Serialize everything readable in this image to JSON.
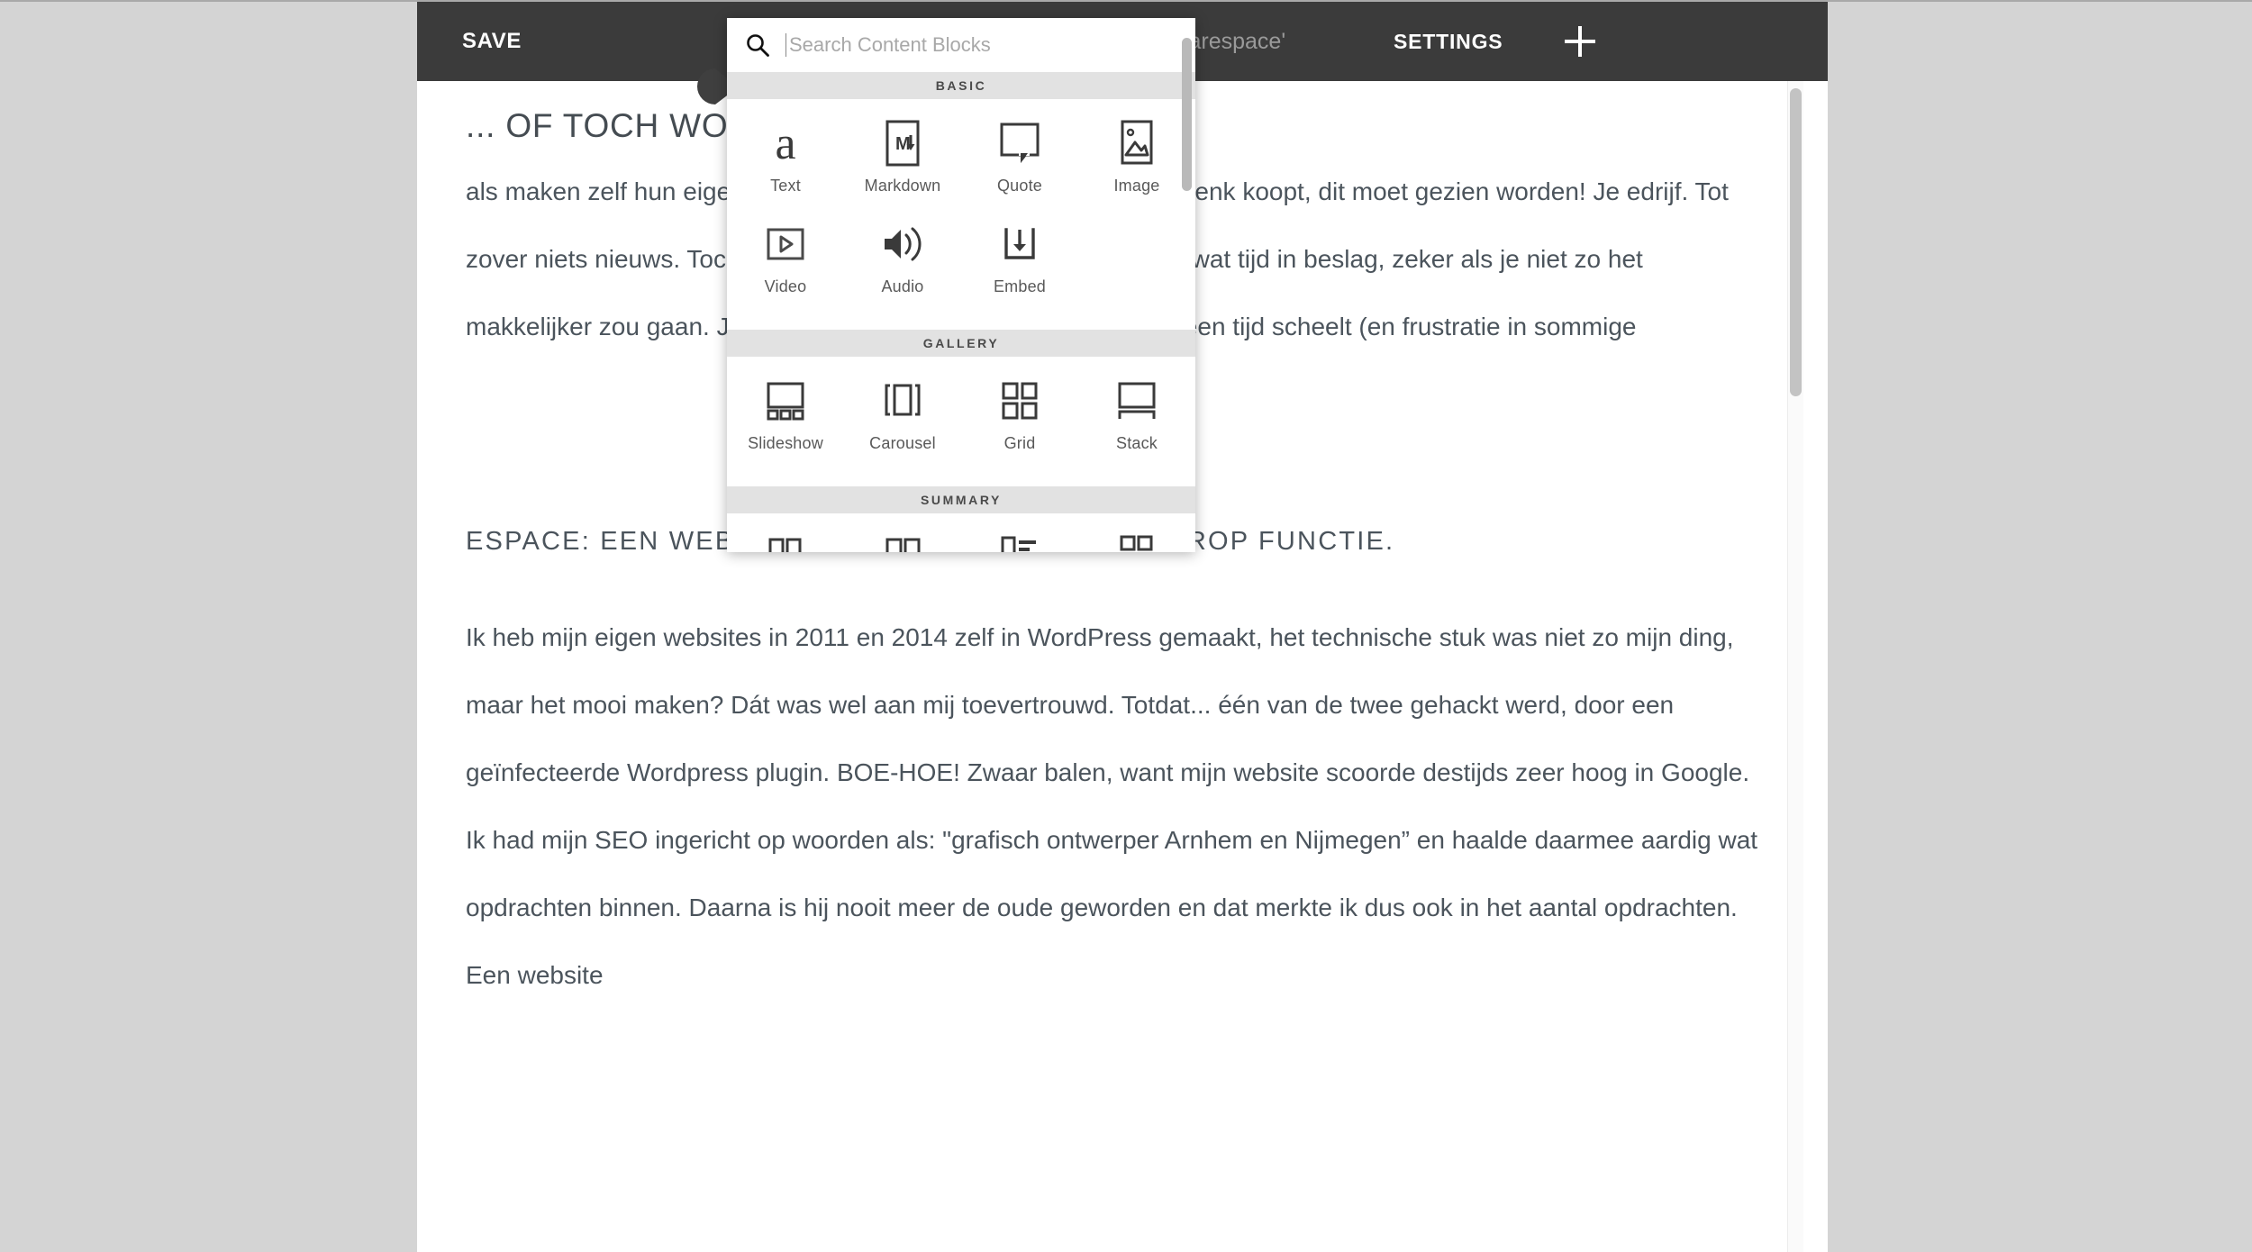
{
  "admin_bar": {
    "save_label": "SAVE",
    "middle_label": "Squarespace'",
    "settings_label": "SETTINGS",
    "add_icon": "plus-icon",
    "background": "#3b3b3b"
  },
  "insert_marker": {
    "icon": "insert-point-teardrop-icon",
    "color": "#3f3f3f"
  },
  "block_panel": {
    "search": {
      "icon": "search-icon",
      "placeholder": "Search Content Blocks",
      "value": ""
    },
    "groups": [
      {
        "title": "BASIC",
        "items": [
          {
            "label": "Text",
            "icon": "text-a-icon"
          },
          {
            "label": "Markdown",
            "icon": "markdown-icon"
          },
          {
            "label": "Quote",
            "icon": "quote-bubble-icon"
          },
          {
            "label": "Image",
            "icon": "image-icon"
          },
          {
            "label": "Video",
            "icon": "video-play-icon"
          },
          {
            "label": "Audio",
            "icon": "audio-speaker-icon"
          },
          {
            "label": "Embed",
            "icon": "embed-download-icon"
          }
        ]
      },
      {
        "title": "GALLERY",
        "items": [
          {
            "label": "Slideshow",
            "icon": "gallery-slideshow-icon"
          },
          {
            "label": "Carousel",
            "icon": "gallery-carousel-icon"
          },
          {
            "label": "Grid",
            "icon": "gallery-grid-icon"
          },
          {
            "label": "Stack",
            "icon": "gallery-stack-icon"
          }
        ]
      },
      {
        "title": "SUMMARY",
        "items": [
          {
            "label": "",
            "icon": "summary-wall-icon"
          },
          {
            "label": "",
            "icon": "summary-grid-icon"
          },
          {
            "label": "",
            "icon": "summary-list-icon"
          },
          {
            "label": "",
            "icon": "summary-carousel-icon"
          }
        ]
      }
    ]
  },
  "article": {
    "title": "... OF TOCH WORDPRESS?",
    "paragraph_1": "als maken zelf hun eigen website in e website kunnen beheren, denk koopt, dit moet gezien worden! Je edrijf. Tot zover niets nieuws. Toch makkelijk (en dat is het uiteindelijk ook) wat tijd in beslag, zeker als je niet zo het makkelijker zou gaan. Je wilt je n met je website. Uitbesteden is een tijd scheelt (en frustratie in sommige",
    "section_heading": "ESPACE: EEN WEBSITE PLATFORM MET DRAG & DROP FUNCTIE.",
    "paragraph_2": "Ik heb mijn eigen websites in 2011 en 2014 zelf in WordPress gemaakt, het technische stuk was niet zo mijn ding, maar het mooi maken? Dát was wel aan mij toevertrouwd.  Totdat... één van de twee gehackt werd, door een geïnfecteerde Wordpress plugin. BOE-HOE!  Zwaar balen, want mijn website scoorde destijds zeer hoog in Google. Ik had mijn SEO ingericht op woorden als: \"grafisch ontwerper Arnhem en Nijmegen” en haalde daarmee aardig wat opdrachten binnen. Daarna is hij nooit meer de oude geworden en dat merkte ik dus ook in het aantal opdrachten. Een website"
  }
}
